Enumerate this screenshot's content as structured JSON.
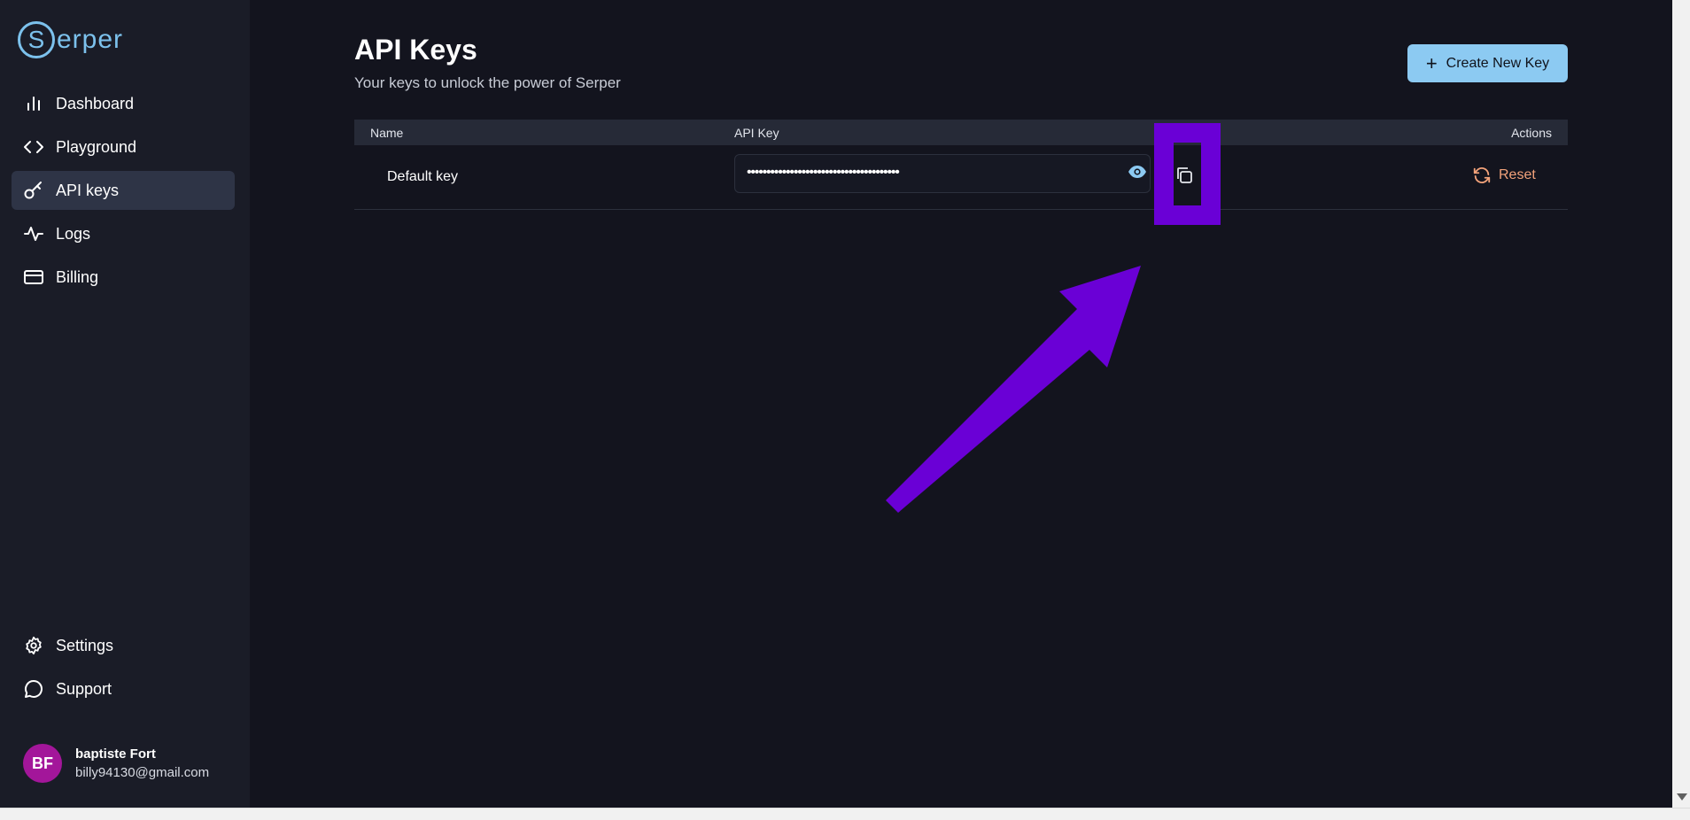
{
  "brand": {
    "logo_letter": "S",
    "logo_text": "erper"
  },
  "sidebar": {
    "items": [
      {
        "label": "Dashboard",
        "icon": "bar-chart-icon"
      },
      {
        "label": "Playground",
        "icon": "code-icon"
      },
      {
        "label": "API keys",
        "icon": "key-icon",
        "active": true
      },
      {
        "label": "Logs",
        "icon": "activity-icon"
      },
      {
        "label": "Billing",
        "icon": "credit-card-icon"
      }
    ],
    "bottom_items": [
      {
        "label": "Settings",
        "icon": "gear-icon"
      },
      {
        "label": "Support",
        "icon": "chat-bubble-icon"
      }
    ]
  },
  "user": {
    "initials": "BF",
    "name": "baptiste Fort",
    "email": "billy94130@gmail.com"
  },
  "header": {
    "title": "API Keys",
    "subtitle": "Your keys to unlock the power of Serper",
    "create_button": "Create New Key"
  },
  "table": {
    "columns": {
      "name": "Name",
      "api_key": "API Key",
      "actions": "Actions"
    },
    "rows": [
      {
        "name": "Default key",
        "masked_key": "•••••••••••••••••••••••••••••••••••••••",
        "reset_label": "Reset"
      }
    ]
  },
  "colors": {
    "accent": "#8ccaf2",
    "reset": "#f2a27a",
    "annotation": "#6a00d6",
    "avatar": "#a3169a"
  }
}
